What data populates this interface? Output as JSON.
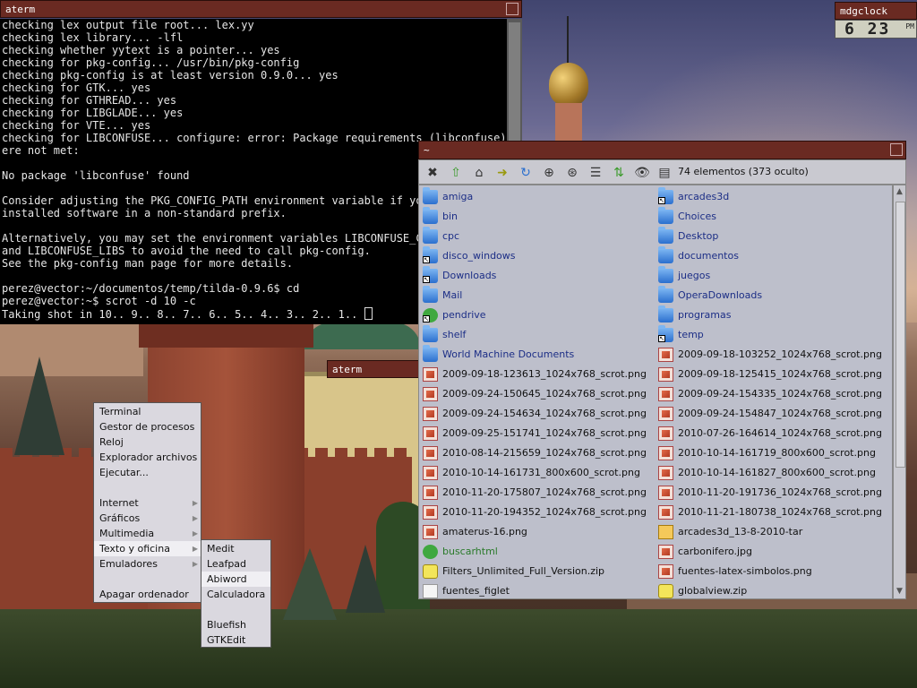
{
  "colors": {
    "titlebar": "#6a2a22",
    "terminal_bg": "#000000",
    "fm_bg": "#bdbfcb",
    "menu_bg": "#dad8df",
    "folder_text": "#1c2e86"
  },
  "terminal1": {
    "title": "aterm",
    "lines": [
      "checking lex output file root... lex.yy",
      "checking lex library... -lfl",
      "checking whether yytext is a pointer... yes",
      "checking for pkg-config... /usr/bin/pkg-config",
      "checking pkg-config is at least version 0.9.0... yes",
      "checking for GTK... yes",
      "checking for GTHREAD... yes",
      "checking for LIBGLADE... yes",
      "checking for VTE... yes",
      "checking for LIBCONFUSE... configure: error: Package requirements (libconfuse) w",
      "ere not met:",
      "",
      "No package 'libconfuse' found",
      "",
      "Consider adjusting the PKG_CONFIG_PATH environment variable if you",
      "installed software in a non-standard prefix.",
      "",
      "Alternatively, you may set the environment variables LIBCONFUSE_CFL",
      "and LIBCONFUSE_LIBS to avoid the need to call pkg-config.",
      "See the pkg-config man page for more details.",
      "",
      "perez@vector:~/documentos/temp/tilda-0.9.6$ cd",
      "perez@vector:~$ scrot -d 10 -c",
      "Taking shot in 10.. 9.. 8.. 7.. 6.. 5.. 4.. 3.. 2.. 1.. "
    ]
  },
  "terminal2": {
    "title": "aterm"
  },
  "clock": {
    "title": "mdgclock",
    "time": "6 23",
    "ampm": "PM"
  },
  "filemanager": {
    "title": "~",
    "status": "74 elementos (373 oculto)",
    "toolbar": [
      "close-icon",
      "up-arrow-icon",
      "home-icon",
      "go-icon",
      "refresh-icon",
      "zoom-in-icon",
      "zoom-fit-icon",
      "list-view-icon",
      "sort-icon",
      "eye-icon",
      "details-icon"
    ],
    "left_column": [
      {
        "name": "amiga",
        "type": "folder"
      },
      {
        "name": "bin",
        "type": "folder"
      },
      {
        "name": "cpc",
        "type": "folder"
      },
      {
        "name": "disco_windows",
        "type": "folder-link"
      },
      {
        "name": "Downloads",
        "type": "folder-link"
      },
      {
        "name": "Mail",
        "type": "folder"
      },
      {
        "name": "pendrive",
        "type": "drive-link"
      },
      {
        "name": "shelf",
        "type": "folder"
      },
      {
        "name": "World Machine Documents",
        "type": "folder"
      },
      {
        "name": "2009-09-18-123613_1024x768_scrot.png",
        "type": "png"
      },
      {
        "name": "2009-09-24-150645_1024x768_scrot.png",
        "type": "png"
      },
      {
        "name": "2009-09-24-154634_1024x768_scrot.png",
        "type": "png"
      },
      {
        "name": "2009-09-25-151741_1024x768_scrot.png",
        "type": "png"
      },
      {
        "name": "2010-08-14-215659_1024x768_scrot.png",
        "type": "png"
      },
      {
        "name": "2010-10-14-161731_800x600_scrot.png",
        "type": "png"
      },
      {
        "name": "2010-11-20-175807_1024x768_scrot.png",
        "type": "png"
      },
      {
        "name": "2010-11-20-194352_1024x768_scrot.png",
        "type": "png"
      },
      {
        "name": "amaterus-16.png",
        "type": "png"
      },
      {
        "name": "buscarhtml",
        "type": "html"
      },
      {
        "name": "Filters_Unlimited_Full_Version.zip",
        "type": "zip"
      },
      {
        "name": "fuentes_figlet",
        "type": "file"
      }
    ],
    "right_column": [
      {
        "name": "arcades3d",
        "type": "folder-link"
      },
      {
        "name": "Choices",
        "type": "folder"
      },
      {
        "name": "Desktop",
        "type": "folder"
      },
      {
        "name": "documentos",
        "type": "folder"
      },
      {
        "name": "juegos",
        "type": "folder"
      },
      {
        "name": "OperaDownloads",
        "type": "folder"
      },
      {
        "name": "programas",
        "type": "folder"
      },
      {
        "name": "temp",
        "type": "folder-link"
      },
      {
        "name": "2009-09-18-103252_1024x768_scrot.png",
        "type": "png"
      },
      {
        "name": "2009-09-18-125415_1024x768_scrot.png",
        "type": "png"
      },
      {
        "name": "2009-09-24-154335_1024x768_scrot.png",
        "type": "png"
      },
      {
        "name": "2009-09-24-154847_1024x768_scrot.png",
        "type": "png"
      },
      {
        "name": "2010-07-26-164614_1024x768_scrot.png",
        "type": "png"
      },
      {
        "name": "2010-10-14-161719_800x600_scrot.png",
        "type": "png"
      },
      {
        "name": "2010-10-14-161827_800x600_scrot.png",
        "type": "png"
      },
      {
        "name": "2010-11-20-191736_1024x768_scrot.png",
        "type": "png"
      },
      {
        "name": "2010-11-21-180738_1024x768_scrot.png",
        "type": "png"
      },
      {
        "name": "arcades3d_13-8-2010-tar",
        "type": "tar"
      },
      {
        "name": "carbonifero.jpg",
        "type": "png"
      },
      {
        "name": "fuentes-latex-simbolos.png",
        "type": "png"
      },
      {
        "name": "globalview.zip",
        "type": "zip"
      }
    ]
  },
  "menu": {
    "items": [
      {
        "label": "Terminal"
      },
      {
        "label": "Gestor de procesos"
      },
      {
        "label": "Reloj"
      },
      {
        "label": "Explorador archivos"
      },
      {
        "label": "Ejecutar..."
      },
      {
        "label": ""
      },
      {
        "label": "Internet",
        "submenu": true
      },
      {
        "label": "Gráficos",
        "submenu": true
      },
      {
        "label": "Multimedia",
        "submenu": true
      },
      {
        "label": "Texto y oficina",
        "submenu": true,
        "selected": true
      },
      {
        "label": "Emuladores",
        "submenu": true
      },
      {
        "label": ""
      },
      {
        "label": "Apagar ordenador"
      }
    ]
  },
  "submenu": {
    "items": [
      {
        "label": "Medit"
      },
      {
        "label": "Leafpad"
      },
      {
        "label": "Abiword",
        "selected": true
      },
      {
        "label": "Calculadora"
      },
      {
        "label": ""
      },
      {
        "label": "Bluefish"
      },
      {
        "label": "GTKEdit"
      }
    ]
  }
}
